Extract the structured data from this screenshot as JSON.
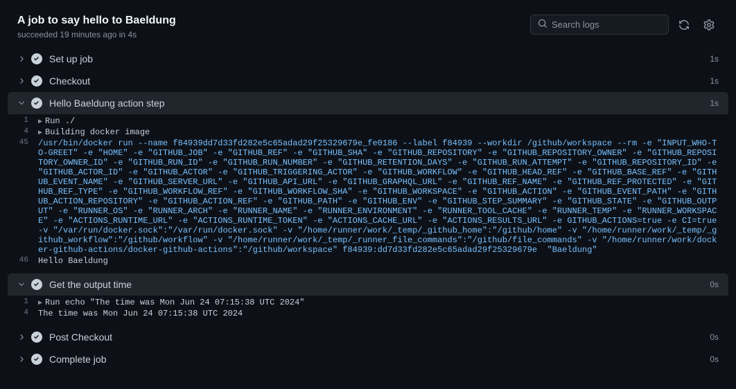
{
  "header": {
    "title": "A job to say hello to Baeldung",
    "subtitle": "succeeded 19 minutes ago in 4s"
  },
  "search": {
    "placeholder": "Search logs"
  },
  "steps": [
    {
      "name": "Set up job",
      "duration": "1s",
      "expanded": false
    },
    {
      "name": "Checkout",
      "duration": "1s",
      "expanded": false
    },
    {
      "name": "Hello Baeldung action step",
      "duration": "1s",
      "expanded": true,
      "lines": [
        {
          "num": "1",
          "caret": true,
          "text": "Run ./"
        },
        {
          "num": "4",
          "caret": true,
          "text": "Building docker image"
        },
        {
          "num": "45",
          "blue": true,
          "text": "/usr/bin/docker run --name f84939dd7d33fd282e5c65adad29f25329679e_fe0186 --label f84939 --workdir /github/workspace --rm -e \"INPUT_WHO-TO-GREET\" -e \"HOME\" -e \"GITHUB_JOB\" -e \"GITHUB_REF\" -e \"GITHUB_SHA\" -e \"GITHUB_REPOSITORY\" -e \"GITHUB_REPOSITORY_OWNER\" -e \"GITHUB_REPOSITORY_OWNER_ID\" -e \"GITHUB_RUN_ID\" -e \"GITHUB_RUN_NUMBER\" -e \"GITHUB_RETENTION_DAYS\" -e \"GITHUB_RUN_ATTEMPT\" -e \"GITHUB_REPOSITORY_ID\" -e \"GITHUB_ACTOR_ID\" -e \"GITHUB_ACTOR\" -e \"GITHUB_TRIGGERING_ACTOR\" -e \"GITHUB_WORKFLOW\" -e \"GITHUB_HEAD_REF\" -e \"GITHUB_BASE_REF\" -e \"GITHUB_EVENT_NAME\" -e \"GITHUB_SERVER_URL\" -e \"GITHUB_API_URL\" -e \"GITHUB_GRAPHQL_URL\" -e \"GITHUB_REF_NAME\" -e \"GITHUB_REF_PROTECTED\" -e \"GITHUB_REF_TYPE\" -e \"GITHUB_WORKFLOW_REF\" -e \"GITHUB_WORKFLOW_SHA\" -e \"GITHUB_WORKSPACE\" -e \"GITHUB_ACTION\" -e \"GITHUB_EVENT_PATH\" -e \"GITHUB_ACTION_REPOSITORY\" -e \"GITHUB_ACTION_REF\" -e \"GITHUB_PATH\" -e \"GITHUB_ENV\" -e \"GITHUB_STEP_SUMMARY\" -e \"GITHUB_STATE\" -e \"GITHUB_OUTPUT\" -e \"RUNNER_OS\" -e \"RUNNER_ARCH\" -e \"RUNNER_NAME\" -e \"RUNNER_ENVIRONMENT\" -e \"RUNNER_TOOL_CACHE\" -e \"RUNNER_TEMP\" -e \"RUNNER_WORKSPACE\" -e \"ACTIONS_RUNTIME_URL\" -e \"ACTIONS_RUNTIME_TOKEN\" -e \"ACTIONS_CACHE_URL\" -e \"ACTIONS_RESULTS_URL\" -e GITHUB_ACTIONS=true -e CI=true -v \"/var/run/docker.sock\":\"/var/run/docker.sock\" -v \"/home/runner/work/_temp/_github_home\":\"/github/home\" -v \"/home/runner/work/_temp/_github_workflow\":\"/github/workflow\" -v \"/home/runner/work/_temp/_runner_file_commands\":\"/github/file_commands\" -v \"/home/runner/work/docker-github-actions/docker-github-actions\":\"/github/workspace\" f84939:dd7d33fd282e5c65adad29f25329679e  \"Baeldung\""
        },
        {
          "num": "46",
          "text": "Hello Baeldung"
        }
      ]
    },
    {
      "name": "Get the output time",
      "duration": "0s",
      "expanded": true,
      "lines": [
        {
          "num": "1",
          "caret": true,
          "text": "Run echo \"The time was Mon Jun 24 07:15:38 UTC 2024\""
        },
        {
          "num": "4",
          "text": "The time was Mon Jun 24 07:15:38 UTC 2024"
        }
      ]
    },
    {
      "name": "Post Checkout",
      "duration": "0s",
      "expanded": false
    },
    {
      "name": "Complete job",
      "duration": "0s",
      "expanded": false
    }
  ]
}
